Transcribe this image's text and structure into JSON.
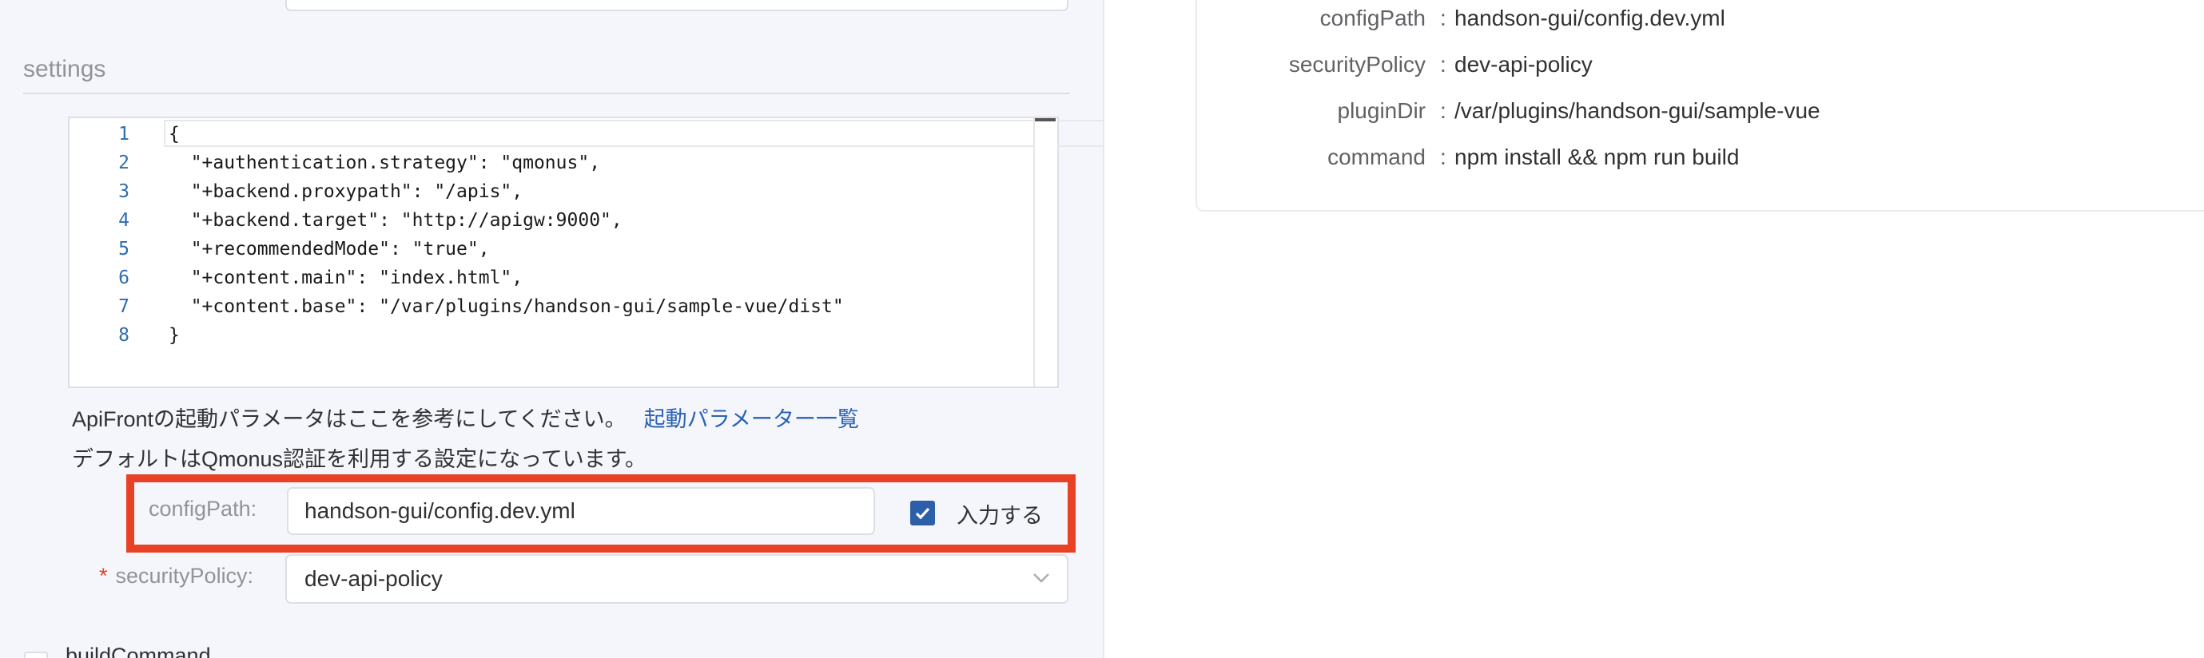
{
  "settings": {
    "section_title": "settings",
    "code_lines": [
      {
        "num": "1",
        "text": "{"
      },
      {
        "num": "2",
        "text": "  \"+authentication.strategy\": \"qmonus\","
      },
      {
        "num": "3",
        "text": "  \"+backend.proxypath\": \"/apis\","
      },
      {
        "num": "4",
        "text": "  \"+backend.target\": \"http://apigw:9000\","
      },
      {
        "num": "5",
        "text": "  \"+recommendedMode\": \"true\","
      },
      {
        "num": "6",
        "text": "  \"+content.main\": \"index.html\","
      },
      {
        "num": "7",
        "text": "  \"+content.base\": \"/var/plugins/handson-gui/sample-vue/dist\""
      },
      {
        "num": "8",
        "text": "}"
      }
    ],
    "help_line1": "ApiFrontの起動パラメータはここを参考にしてください。",
    "help_link": "起動パラメーター一覧",
    "help_line2": "デフォルトはQmonus認証を利用する設定になっています。"
  },
  "form": {
    "config_path": {
      "label": "configPath:",
      "value": "handson-gui/config.dev.yml",
      "checkbox_label": "入力する",
      "checked": true
    },
    "security_policy": {
      "required_mark": "*",
      "label": "securityPolicy:",
      "value": "dev-api-policy"
    },
    "next_field_label": "buildCommand"
  },
  "detail": {
    "separator": ":",
    "rows": [
      {
        "key": "configPath",
        "value": "handson-gui/config.dev.yml"
      },
      {
        "key": "securityPolicy",
        "value": "dev-api-policy"
      },
      {
        "key": "pluginDir",
        "value": "/var/plugins/handson-gui/sample-vue"
      },
      {
        "key": "command",
        "value": "npm install && npm run build"
      }
    ]
  },
  "colors": {
    "highlight": "#e84126",
    "checkbox": "#2d5fa8",
    "link": "#2a62b6",
    "line_number": "#2f6cb0"
  }
}
